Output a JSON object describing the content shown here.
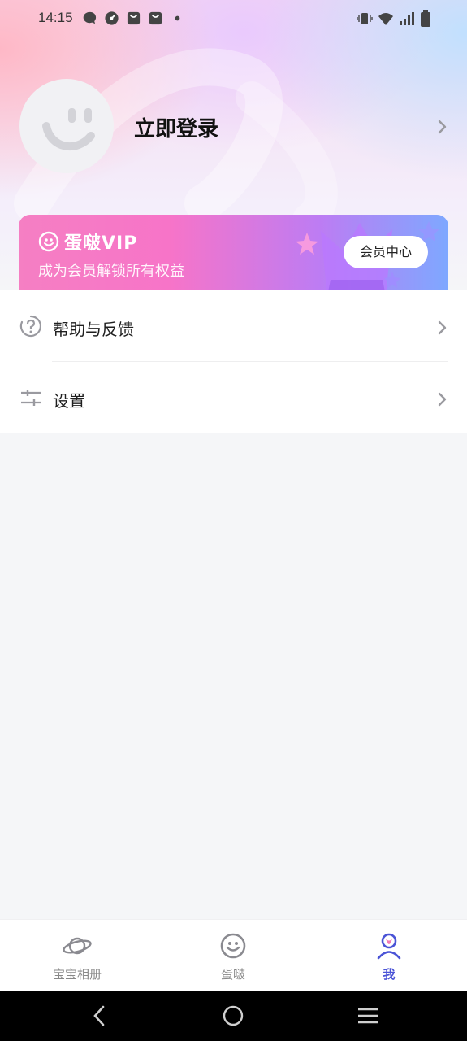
{
  "status_bar": {
    "time": "14:15",
    "left_icons": [
      "message-icon",
      "speedometer-icon",
      "shopping-bag-icon",
      "shopping-bag-icon",
      "dot-icon"
    ],
    "right_icons": [
      "vibrate-icon",
      "wifi-icon",
      "signal-icon",
      "battery-icon"
    ]
  },
  "profile": {
    "login_label": "立即登录"
  },
  "vip_card": {
    "brand": "蛋啵VIP",
    "subtitle": "成为会员解锁所有权益",
    "button_label": "会员中心"
  },
  "menu": {
    "items": [
      {
        "label": "帮助与反馈",
        "icon": "help-icon"
      },
      {
        "label": "设置",
        "icon": "settings-sliders-icon"
      }
    ]
  },
  "tabs": [
    {
      "label": "宝宝相册",
      "icon": "planet-icon",
      "active": false
    },
    {
      "label": "蛋啵",
      "icon": "smiley-icon",
      "active": false
    },
    {
      "label": "我",
      "icon": "person-icon",
      "active": true
    }
  ],
  "colors": {
    "accent": "#4a53d6",
    "vip_gradient_start": "#f57fc3",
    "vip_gradient_end": "#7ea8ff"
  }
}
